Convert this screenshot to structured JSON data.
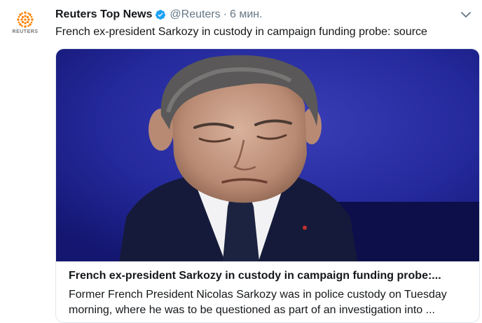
{
  "tweet": {
    "author_name": "Reuters Top News",
    "handle": "@Reuters",
    "separator": "·",
    "time": "6 мин.",
    "text": "French ex-president Sarkozy in custody in campaign funding probe: source",
    "avatar_label": "REUTERS",
    "verified_icon": "verified-badge-icon",
    "menu_icon": "chevron-down-icon"
  },
  "card": {
    "title": "French ex-president Sarkozy in custody in campaign funding probe:...",
    "description": "Former French President Nicolas Sarkozy was in police custody on Tuesday morning, where he was to be questioned as part of an investigation into ..."
  },
  "colors": {
    "brand_orange": "#ff8000",
    "verified_blue": "#1da1f2",
    "muted_gray": "#657786",
    "photo_background": "#1c1f8a"
  }
}
